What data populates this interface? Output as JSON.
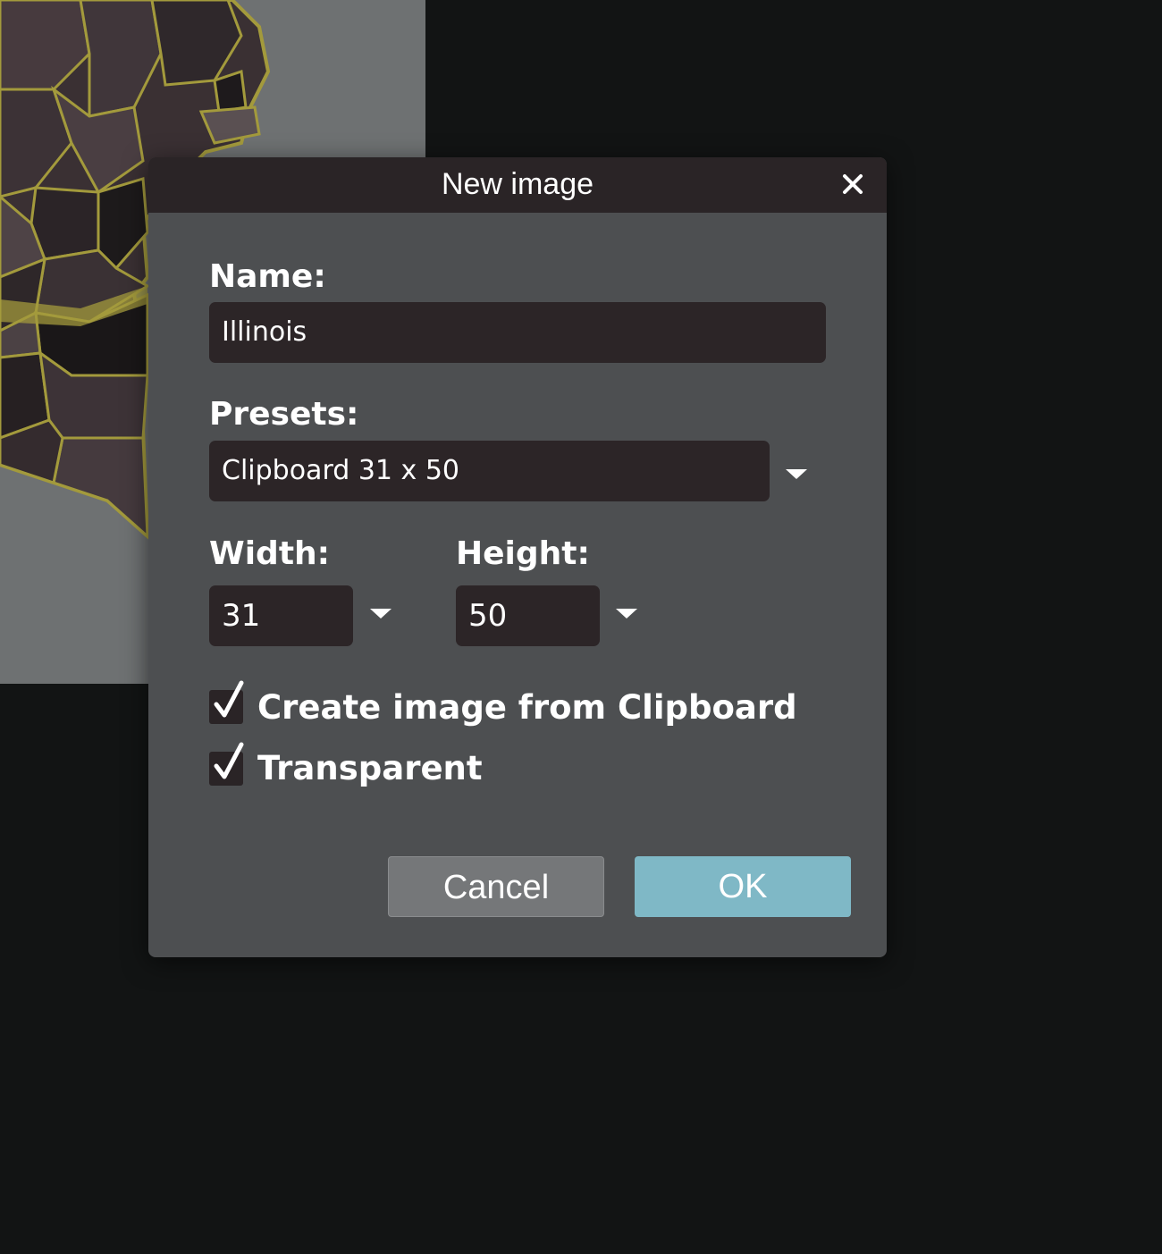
{
  "background_document": {
    "description_icon": "us-map-canvas"
  },
  "dialog": {
    "title": "New image",
    "close_icon": "close-icon",
    "name_label": "Name:",
    "name_value": "Illinois",
    "presets_label": "Presets:",
    "presets_value": "Clipboard 31 x 50",
    "width_label": "Width:",
    "width_value": "31",
    "height_label": "Height:",
    "height_value": "50",
    "options": [
      {
        "label": "Create image from Clipboard",
        "checked": true
      },
      {
        "label": "Transparent",
        "checked": true
      }
    ],
    "cancel_label": "Cancel",
    "ok_label": "OK"
  },
  "colors": {
    "workspace_bg": "#121414",
    "dialog_bg": "#4d4f51",
    "titlebar_bg": "#2a2426",
    "field_bg": "#2c2527",
    "ok_bg": "#7fb8c6",
    "cancel_bg": "#757779"
  }
}
